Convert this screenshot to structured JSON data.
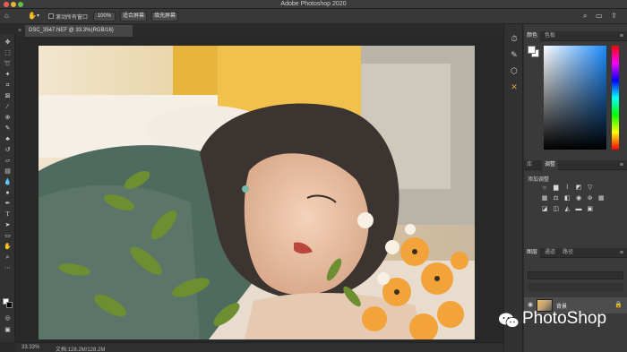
{
  "window": {
    "title": "Adobe Photoshop 2020"
  },
  "options_bar": {
    "scroll_all_windows_label": "滚动所有窗口",
    "zoom_value": "100%",
    "fit_screen_label": "适合屏幕",
    "fill_screen_label": "填充屏幕",
    "icons": [
      "home-icon",
      "hand-tool-icon",
      "search-icon",
      "workspace-icon",
      "share-icon"
    ]
  },
  "document": {
    "tab_label": "DSC_3547.NEF @ 33.3%(RGB/16)",
    "close_glyph": "×"
  },
  "status_bar": {
    "zoom": "33.33%",
    "doc_info": "文档:128.2M/128.2M"
  },
  "panels": {
    "color_tabs": [
      "颜色",
      "色板"
    ],
    "adjust_tabs": [
      "库",
      "调整"
    ],
    "adjust_label": "添加调整",
    "layers_tabs": [
      "图层",
      "通道",
      "路径"
    ],
    "layer_name": "背景"
  },
  "watermark": {
    "text": "PhotoShop"
  },
  "colors": {
    "traffic_red": "#ec5f57",
    "traffic_yellow": "#e0b43d",
    "traffic_green": "#5fbf4a",
    "accent_orange": "#f2a33a"
  }
}
